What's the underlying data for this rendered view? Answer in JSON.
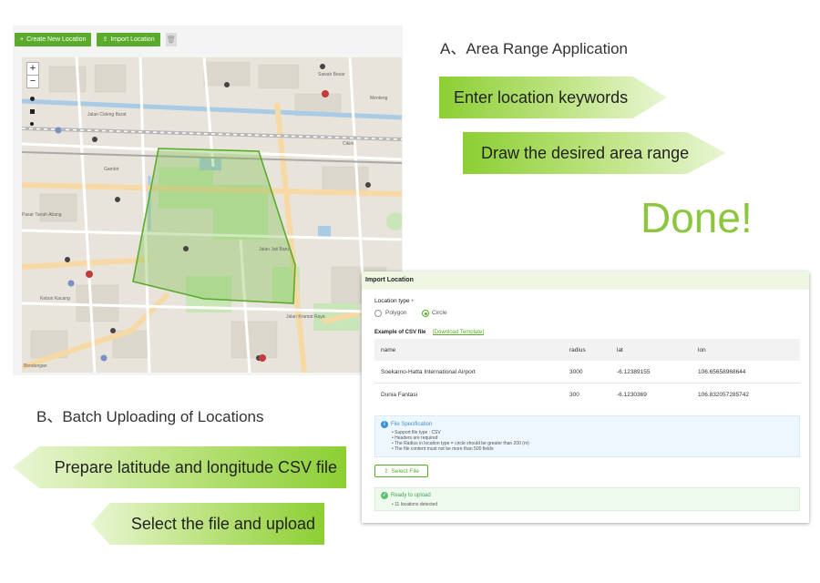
{
  "toolbar": {
    "create_label": "Create New Location",
    "import_label": "Import Location",
    "create_icon": "plus-icon",
    "import_icon": "upload-icon",
    "delete_icon": "trash-icon"
  },
  "map": {
    "zoom_in": "+",
    "zoom_out": "−",
    "labels": [
      "Pasar Tanah Abang",
      "Jalan Cideng Barat",
      "Sawah Besar",
      "Cikini",
      "Gambir",
      "Kebon Kacang",
      "Menteng",
      "Jalan Jati Baru",
      "Jalan Kramat Raya",
      "Bendungan"
    ],
    "accent_color": "#5aab2b",
    "area_fill": "rgba(120,190,70,0.35)"
  },
  "section_a": {
    "title": "A、Area Range Application",
    "step1": "Enter location keywords",
    "step2": "Draw the desired area range",
    "done": "Done!"
  },
  "section_b": {
    "title": "B、Batch Uploading of Locations",
    "step1": "Prepare latitude and longitude CSV file",
    "step2": "Select the file and upload"
  },
  "dialog": {
    "title": "Import Location",
    "location_type_label": "Location type",
    "required_mark": "•",
    "option_polygon": "Polygon",
    "option_circle": "Circle",
    "selected_option": "Circle",
    "example_label": "Example of CSV file",
    "download_link": "[Download Template]",
    "table": {
      "headers": [
        "name",
        "radius",
        "lat",
        "lon"
      ],
      "rows": [
        [
          "Soekarno-Hatta International Airport",
          "3000",
          "-6.12389155",
          "106.65658968644"
        ],
        [
          "Dunia Fantasi",
          "300",
          "-6.1230369",
          "106.832057285742"
        ]
      ]
    },
    "spec_title": "File Specification",
    "spec_items": [
      "Support file type : CSV",
      "Headers are required",
      "The Radius in location type = circle should be greater than 200 (m)",
      "The file content must not be more than 500 fields"
    ],
    "select_file_label": "Select File",
    "ready_title": "Ready to upload",
    "ready_items": [
      "11 locations detected"
    ]
  }
}
